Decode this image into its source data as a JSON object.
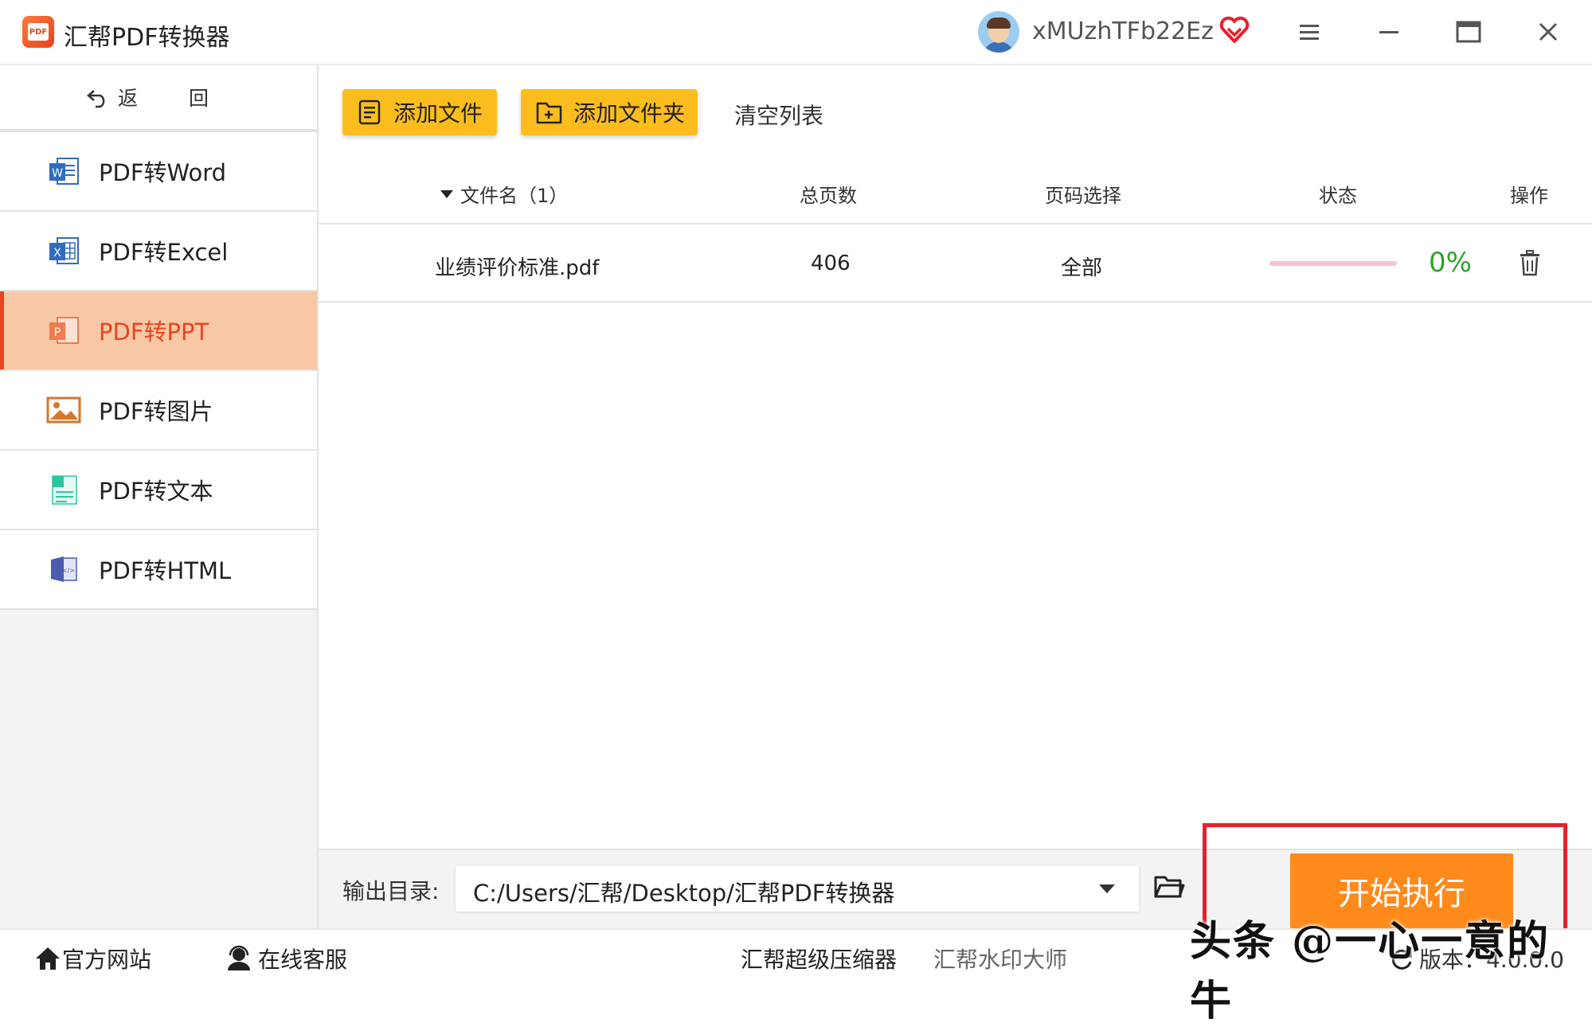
{
  "titlebar": {
    "app_title": "汇帮PDF转换器",
    "username": "xMUzhTFb22Ez",
    "icons": [
      "app-logo-icon",
      "avatar",
      "vip-heart-icon",
      "menu-icon",
      "minimize-icon",
      "maximize-icon",
      "close-icon"
    ]
  },
  "sidebar": {
    "back_label": "返 回",
    "items": [
      {
        "label": "PDF转Word",
        "icon": "word-icon",
        "active": false
      },
      {
        "label": "PDF转Excel",
        "icon": "excel-icon",
        "active": false
      },
      {
        "label": "PDF转PPT",
        "icon": "ppt-icon",
        "active": true
      },
      {
        "label": "PDF转图片",
        "icon": "image-icon",
        "active": false
      },
      {
        "label": "PDF转文本",
        "icon": "text-icon",
        "active": false
      },
      {
        "label": "PDF转HTML",
        "icon": "html-icon",
        "active": false
      }
    ]
  },
  "toolbar": {
    "add_file": "添加文件",
    "add_folder": "添加文件夹",
    "clear_list": "清空列表"
  },
  "table": {
    "headers": {
      "filename": "文件名（1）",
      "pages": "总页数",
      "page_select": "页码选择",
      "status": "状态",
      "action": "操作"
    },
    "rows": [
      {
        "filename": "业绩评价标准.pdf",
        "pages": "406",
        "page_select": "全部",
        "progress": 0,
        "progress_text": "0%"
      }
    ]
  },
  "output": {
    "label": "输出目录:",
    "path": "C:/Users/汇帮/Desktop/汇帮PDF转换器",
    "start_button": "开始执行"
  },
  "footer": {
    "website": "官方网站",
    "support": "在线客服",
    "compressor": "汇帮超级压缩器",
    "watermark_tool": "汇帮水印大师",
    "version": "版本：4.0.0.0"
  },
  "overlay_watermark": "头条 @一心一意的牛",
  "colors": {
    "accent_orange": "#ff8a1c",
    "active_nav_bg": "#f8c8a6",
    "active_nav_text": "#e8451e",
    "button_yellow": "#fbbd1d",
    "progress_text": "#2aa52a",
    "highlight_box": "#e8202a"
  }
}
